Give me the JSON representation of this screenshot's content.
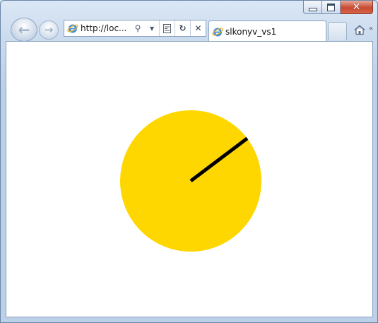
{
  "browser": {
    "address": {
      "url_text": "http://loc..."
    },
    "tab": {
      "title": "slkonyv_vs1"
    }
  },
  "icons": {
    "back": "back-arrow-icon",
    "forward": "forward-arrow-icon",
    "search": "search-icon",
    "dropdown": "chevron-down-icon",
    "compat": "compatibility-view-icon",
    "refresh": "refresh-icon",
    "stop": "stop-icon",
    "home": "home-icon",
    "ie": "ie-logo-icon"
  },
  "colors": {
    "circle_fill": "#FFD700",
    "hand": "#000000",
    "close_button": "#C94A31"
  },
  "drawing": {
    "shape": "circle",
    "hand_angle_deg": 37
  }
}
